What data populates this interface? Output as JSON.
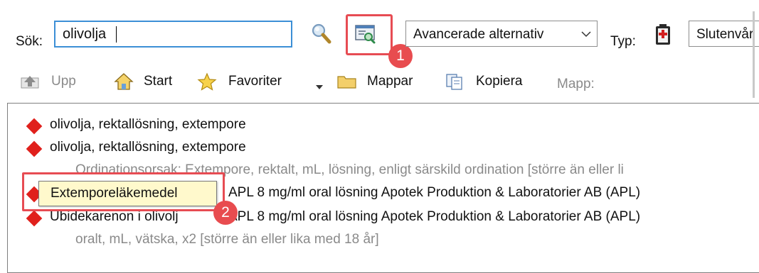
{
  "search": {
    "label": "Sök:",
    "value": "olivolja"
  },
  "advanced_select": {
    "value": "Avancerade alternativ"
  },
  "type": {
    "label": "Typ:",
    "value": "Slutenvår"
  },
  "toolbar": {
    "up": "Upp",
    "start": "Start",
    "favorites": "Favoriter",
    "folders": "Mappar",
    "copy": "Kopiera",
    "folder_label": "Mapp:"
  },
  "results": [
    {
      "text": "olivolja, rektallösning, extempore"
    },
    {
      "text": "olivolja, rektallösning, extempore",
      "detail": "Ordinationsorsak: Extempore, rektalt, mL, lösning, enligt särskild ordination [större än eller li"
    },
    {
      "text_visible": "APL 8 mg/ml oral lösning Apotek Produktion & Laboratorier AB (APL)"
    },
    {
      "text_prefix": "Ubidekarenon i olivolj",
      "text_suffix": "APL 8 mg/ml oral lösning Apotek Produktion & Laboratorier AB (APL)",
      "detail": "oralt, mL, vätska, x2 [större än eller lika med 18 år]"
    }
  ],
  "tooltip": "Extemporeläkemedel",
  "annotations": {
    "badge1": "1",
    "badge2": "2"
  },
  "colors": {
    "accent_red": "#e74c53",
    "diamond_red": "#e0201c",
    "input_border": "#3c8fd6",
    "tooltip_bg": "#fff9cc"
  },
  "icons": {
    "search": "magnifier-icon",
    "advanced_search": "advanced-search-icon",
    "type": "medicine-type-icon",
    "up": "up-arrow-icon",
    "start": "home-icon",
    "favorites": "star-icon",
    "folders": "folder-icon",
    "copy": "copy-icon"
  }
}
